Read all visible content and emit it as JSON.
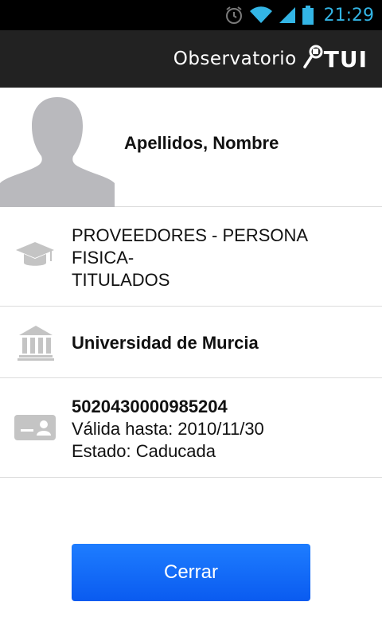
{
  "status_bar": {
    "time": "21:29",
    "icons": [
      "alarm-icon",
      "wifi-icon",
      "signal-icon",
      "battery-icon"
    ],
    "accent_color": "#33b5e5"
  },
  "action_bar": {
    "title": "Observatorio",
    "logo_text": "TUI",
    "logo_icon": "key-icon",
    "background": "#222222"
  },
  "profile": {
    "name": "Apellidos, Nombre",
    "avatar_icon": "person-silhouette-icon"
  },
  "rows": {
    "collective": {
      "icon": "graduation-cap-icon",
      "lines": [
        "PROVEEDORES - PERSONA",
        "FISICA-",
        "TITULADOS"
      ]
    },
    "university": {
      "icon": "institution-icon",
      "label": "Universidad de Murcia"
    },
    "card": {
      "icon": "id-card-icon",
      "number": "5020430000985204",
      "valid_until": "Válida hasta: 2010/11/30",
      "status": "Estado: Caducada"
    }
  },
  "close_button": {
    "label": "Cerrar",
    "color": "#0f66f5"
  }
}
